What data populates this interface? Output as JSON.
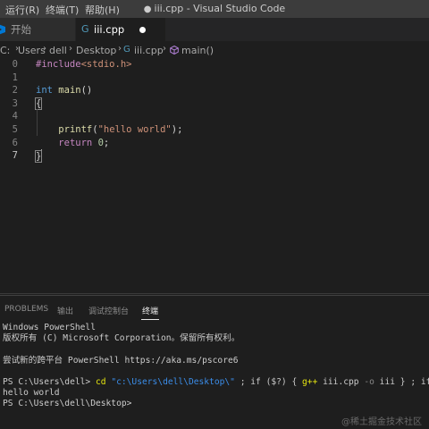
{
  "titlebar": {
    "menu": [
      "运行(R)",
      "终端(T)",
      "帮助(H)"
    ],
    "dirty_dot": "●",
    "title": "iii.cpp - Visual Studio Code"
  },
  "tabs": {
    "welcome_label": "开始",
    "file_label": "iii.cpp"
  },
  "breadcrumb": [
    "C:",
    "Users",
    "dell",
    "Desktop",
    "iii.cpp",
    "main()"
  ],
  "editor": {
    "lines": [
      {
        "n": "0",
        "tokens": [
          {
            "t": "#include",
            "c": "tok-pre"
          },
          {
            "t": "<stdio.h>",
            "c": "tok-hdr"
          }
        ]
      },
      {
        "n": "1",
        "tokens": []
      },
      {
        "n": "2",
        "tokens": [
          {
            "t": "int",
            "c": "tok-kw"
          },
          {
            "t": " ",
            "c": "tok-pun"
          },
          {
            "t": "main",
            "c": "tok-fn"
          },
          {
            "t": "()",
            "c": "tok-pun"
          }
        ]
      },
      {
        "n": "3",
        "tokens": [
          {
            "t": "{",
            "c": "tok-pun brace-box"
          }
        ]
      },
      {
        "n": "4",
        "tokens": []
      },
      {
        "n": "5",
        "tokens": [
          {
            "t": "    ",
            "c": "tok-pun"
          },
          {
            "t": "printf",
            "c": "tok-fn"
          },
          {
            "t": "(",
            "c": "tok-pun"
          },
          {
            "t": "\"hello world\"",
            "c": "tok-str"
          },
          {
            "t": ");",
            "c": "tok-pun"
          }
        ]
      },
      {
        "n": "6",
        "tokens": [
          {
            "t": "    ",
            "c": "tok-pun"
          },
          {
            "t": "return",
            "c": "tok-ctl"
          },
          {
            "t": " ",
            "c": "tok-pun"
          },
          {
            "t": "0",
            "c": "tok-num"
          },
          {
            "t": ";",
            "c": "tok-pun"
          }
        ]
      },
      {
        "n": "7",
        "tokens": [
          {
            "t": "}",
            "c": "tok-pun brace-box"
          }
        ],
        "cursor": true,
        "active": true
      }
    ]
  },
  "panel": {
    "tabs": [
      "PROBLEMS",
      "输出",
      "调试控制台",
      "终端"
    ],
    "active_tab": "终端"
  },
  "terminal": {
    "lines": [
      [
        {
          "t": "Windows PowerShell",
          "c": ""
        }
      ],
      [
        {
          "t": "版权所有 (C) Microsoft Corporation。保留所有权利。",
          "c": ""
        }
      ],
      [],
      [
        {
          "t": "尝试新的跨平台 PowerShell https://aka.ms/pscore6",
          "c": ""
        }
      ],
      [],
      [
        {
          "t": "PS C:\\Users\\dell> ",
          "c": ""
        },
        {
          "t": "cd",
          "c": "t-cmd"
        },
        {
          "t": " ",
          "c": ""
        },
        {
          "t": "\"c:\\Users\\dell\\Desktop\\\"",
          "c": "t-str"
        },
        {
          "t": " ; if ($?) { ",
          "c": ""
        },
        {
          "t": "g++",
          "c": "t-exe"
        },
        {
          "t": " iii.cpp ",
          "c": ""
        },
        {
          "t": "-o",
          "c": "t-flag"
        },
        {
          "t": " iii } ; if (",
          "c": ""
        }
      ],
      [
        {
          "t": "hello world",
          "c": ""
        }
      ],
      [
        {
          "t": "PS C:\\Users\\dell\\Desktop>",
          "c": ""
        }
      ]
    ]
  },
  "watermark": "@稀土掘金技术社区",
  "colors": {
    "titlebar_bg": "#3c3c3c",
    "editor_bg": "#1e1e1e",
    "keyword": "#569cd6",
    "function": "#dcdcaa",
    "string": "#ce9178"
  }
}
